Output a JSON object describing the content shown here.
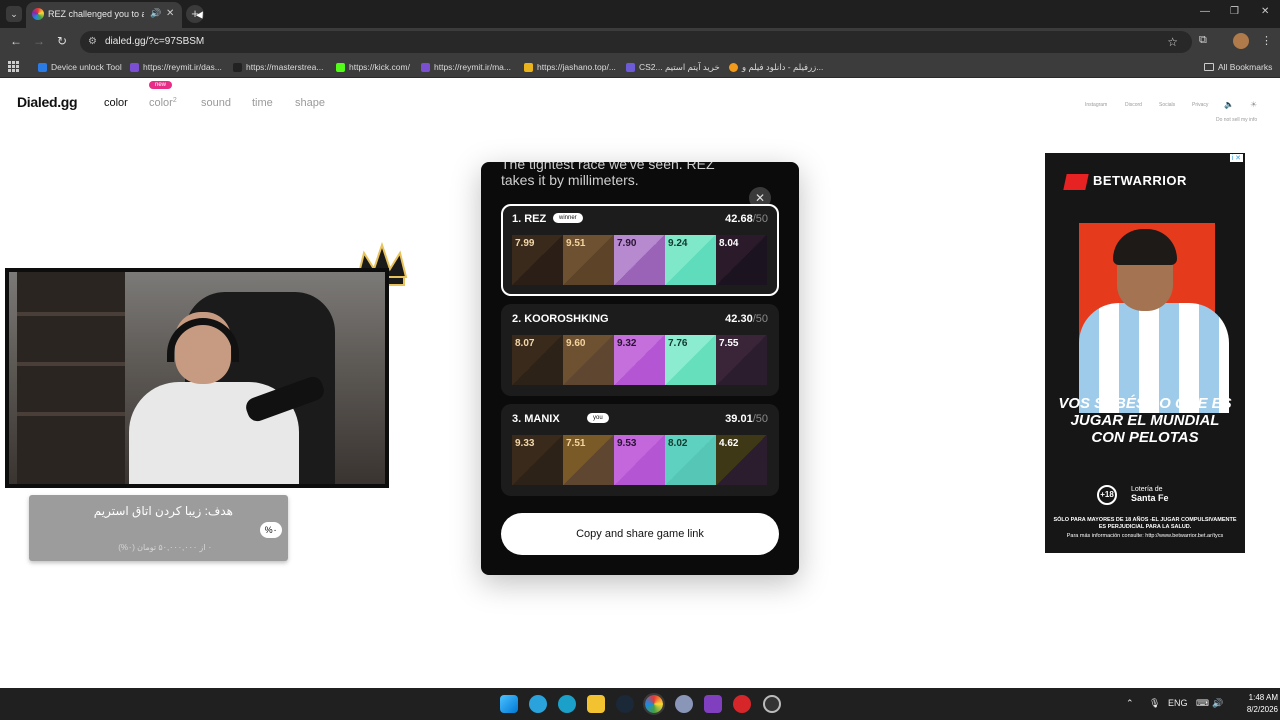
{
  "browser": {
    "tab_title": "REZ challenged you to a color",
    "url": "dialed.gg/?c=97SBSM",
    "bookmarks": [
      "Device unlock Tool",
      "https://reymit.ir/das...",
      "https://masterstrea...",
      "https://kick.com/",
      "https://reymit.ir/ma...",
      "https://jashano.top/...",
      "CS2... خرید آیتم استیم",
      "زرفیلم - دانلود فیلم و..."
    ],
    "all_bookmarks": "All Bookmarks"
  },
  "site": {
    "logo": "Dialed.gg",
    "nav": {
      "color": "color",
      "color2": "color",
      "color2_sup": "2",
      "new_badge": "new",
      "sound": "sound",
      "time": "time",
      "shape": "shape"
    },
    "footer_links": {
      "instagram": "Instagram",
      "discord": "Discord",
      "socials": "Socials",
      "privacy": "Privacy",
      "do_not_sell": "Do not sell my info"
    }
  },
  "stream_overlay": {
    "goal_title": "هدف: زیبا کردن اتاق استریم",
    "goal_percent": "%۰",
    "goal_progress": "۰ از ۵۰,۰۰۰,۰۰۰ تومان (۰%)"
  },
  "result": {
    "headline": "The tightest race we've seen. REZ takes it by millimeters.",
    "players": [
      {
        "rank_name": "1.  REZ",
        "badge": "winner",
        "score": "42.68",
        "max": "/50",
        "swatches": [
          {
            "value": "7.99",
            "target": "#3a2a1c",
            "guess": "#2a1e16",
            "text": "#f2d7a8"
          },
          {
            "value": "9.51",
            "target": "#6e5131",
            "guess": "#5d4328",
            "text": "#f5d49e"
          },
          {
            "value": "7.90",
            "target": "#b78ad0",
            "guess": "#9b63b8",
            "text": "#2a1233"
          },
          {
            "value": "9.24",
            "target": "#7fe8c9",
            "guess": "#5fdcbb",
            "text": "#113a2e"
          },
          {
            "value": "8.04",
            "target": "#2b1a2a",
            "guess": "#1c1320",
            "text": "#ffffff"
          }
        ]
      },
      {
        "rank_name": "2.  KOOROSHKING",
        "badge": "",
        "score": "42.30",
        "max": "/50",
        "swatches": [
          {
            "value": "8.07",
            "target": "#3a2a1c",
            "guess": "#2c2218",
            "text": "#f2d7a8"
          },
          {
            "value": "9.60",
            "target": "#6e5131",
            "guess": "#5e4630",
            "text": "#f5d49e"
          },
          {
            "value": "9.32",
            "target": "#c46fdc",
            "guess": "#b455d4",
            "text": "#2a1233"
          },
          {
            "value": "7.76",
            "target": "#8beccf",
            "guess": "#66dfbd",
            "text": "#113a2e"
          },
          {
            "value": "7.55",
            "target": "#3a2438",
            "guess": "#2b1d2d",
            "text": "#ffffff"
          }
        ]
      },
      {
        "rank_name": "3.  MANIX",
        "badge": "you",
        "score": "39.01",
        "max": "/50",
        "swatches": [
          {
            "value": "9.33",
            "target": "#3a2a1c",
            "guess": "#2c2218",
            "text": "#f2d7a8"
          },
          {
            "value": "7.51",
            "target": "#7a5a26",
            "guess": "#5e4630",
            "text": "#f5d49e"
          },
          {
            "value": "9.53",
            "target": "#c466dc",
            "guess": "#b455d4",
            "text": "#2a1233"
          },
          {
            "value": "8.02",
            "target": "#5fd1c0",
            "guess": "#56c7b6",
            "text": "#113a2e"
          },
          {
            "value": "4.62",
            "target": "#3f3816",
            "guess": "#2b1d2d",
            "text": "#ffffff"
          }
        ]
      }
    ],
    "copy_button": "Copy and share game link"
  },
  "ad": {
    "brand": "BETWARRIOR",
    "headline": "VOS SABÉS LO QUE ES JUGAR EL MUNDIAL CON PELOTAS",
    "age": "+18",
    "lottery_line1": "Lotería de",
    "lottery_line2": "Santa Fe",
    "legal1": "SÓLO PARA MAYORES DE 18 AÑOS -EL JUGAR COMPULSIVAMENTE ES PERJUDICIAL PARA LA SALUD.",
    "legal2": "Para más información consulte: http://www.betwarrior.bet.ar/tycs",
    "info_mark": "i ✕"
  },
  "taskbar": {
    "lang": "ENG",
    "time": "1:48 AM",
    "date": "8/2/2026"
  },
  "colors": {
    "accent_new_badge": "#e62e87",
    "modal_bg": "#0b0b0b",
    "card_bg": "#1c1c1c"
  },
  "icons": [
    "search-icon",
    "speaker-icon",
    "close-icon",
    "plus-icon",
    "back-icon",
    "forward-icon",
    "reload-icon",
    "star-icon",
    "extensions-icon",
    "menu-icon",
    "apps-grid-icon",
    "folder-icon",
    "volume-icon",
    "brightness-icon",
    "windows-icon"
  ]
}
